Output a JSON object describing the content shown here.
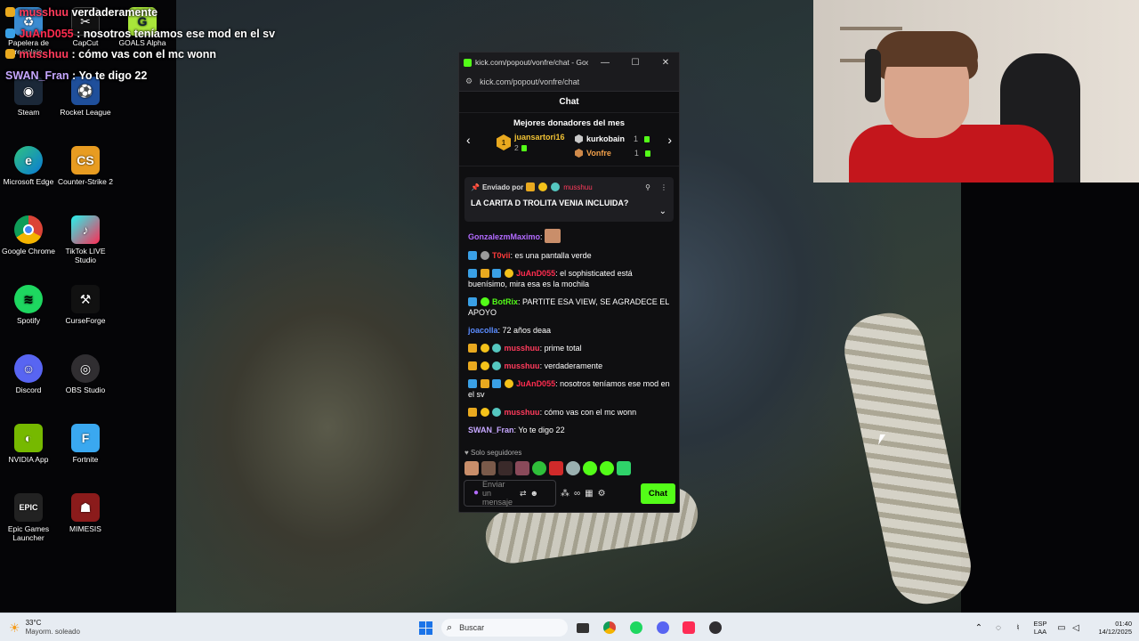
{
  "overlay_chat": [
    {
      "user": "musshuu",
      "text": "verdaderamente",
      "user_color": "#ff3b5c"
    },
    {
      "user": "JuAnD055",
      "text": ": nosotros teníamos ese mod en el sv",
      "user_color": "#ff2c4f"
    },
    {
      "user": "musshuu",
      "text": ": cómo vas con el mc wonn",
      "user_color": "#ff3b5c"
    },
    {
      "user": "SWAN_Fran",
      "text": ": Yo te digo 22",
      "user_color": "#c6a7ff"
    }
  ],
  "desktop": {
    "icons": [
      {
        "label": "Papelera de reciclaje",
        "icon": "recycle-bin-icon"
      },
      {
        "label": "CapCut",
        "icon": "capcut-icon"
      },
      {
        "label": "GOALS Alpha",
        "icon": "goals-icon"
      },
      {
        "label": "Steam",
        "icon": "steam-icon"
      },
      {
        "label": "Rocket League",
        "icon": "rocket-league-icon"
      },
      {
        "label": "Microsoft Edge",
        "icon": "edge-icon"
      },
      {
        "label": "Counter-Strike 2",
        "icon": "cs2-icon"
      },
      {
        "label": "Google Chrome",
        "icon": "chrome-icon"
      },
      {
        "label": "TikTok LIVE Studio",
        "icon": "tiktok-icon"
      },
      {
        "label": "Spotify",
        "icon": "spotify-icon"
      },
      {
        "label": "CurseForge",
        "icon": "curseforge-icon"
      },
      {
        "label": "Discord",
        "icon": "discord-icon"
      },
      {
        "label": "OBS Studio",
        "icon": "obs-icon"
      },
      {
        "label": "NVIDIA App",
        "icon": "nvidia-icon"
      },
      {
        "label": "Fortnite",
        "icon": "fortnite-icon"
      },
      {
        "label": "Epic Games Launcher",
        "icon": "epic-icon"
      },
      {
        "label": "MIMESIS",
        "icon": "mimesis-icon"
      }
    ]
  },
  "chat_window": {
    "title": "kick.com/popout/vonfre/chat - Googl...",
    "url": "kick.com/popout/vonfre/chat",
    "header": "Chat",
    "donors_title": "Mejores donadores del mes",
    "donors": [
      {
        "rank": "1",
        "name": "juansartori16",
        "count": "2"
      },
      {
        "rank": "2",
        "name": "kurkobain",
        "count": "1"
      },
      {
        "rank": "3",
        "name": "Vonfre",
        "count": "1"
      }
    ],
    "pinned": {
      "sent_by": "Enviado por",
      "user": "musshuu",
      "message": "LA CARITA D TROLITA VENIA INCLUIDA?"
    },
    "messages": [
      {
        "user": "GonzalezmMaximo",
        "text": ":",
        "color": "#b36bff"
      },
      {
        "user": "T0vii",
        "text": ": es una pantalla verde",
        "color": "#ff3b3b"
      },
      {
        "user": "JuAnD055",
        "text": ": el sophisticated está buenísimo, mira esa es la mochila",
        "color": "#ff2c4f"
      },
      {
        "user": "BotRix",
        "text": ": PARTITE ESA VIEW, SE AGRADECE EL APOYO",
        "color": "#53fc18"
      },
      {
        "user": "joacolla",
        "text": ": 72 años deaa",
        "color": "#5b8cff"
      },
      {
        "user": "musshuu",
        "text": ": prime total",
        "color": "#ff3b5c"
      },
      {
        "user": "musshuu",
        "text": ": verdaderamente",
        "color": "#ff3b5c"
      },
      {
        "user": "JuAnD055",
        "text": ": nosotros teníamos ese mod en el sv",
        "color": "#ff2c4f"
      },
      {
        "user": "musshuu",
        "text": ": cómo vas con el mc wonn",
        "color": "#ff3b5c"
      },
      {
        "user": "SWAN_Fran",
        "text": ": Yo te digo 22",
        "color": "#c6a7ff"
      }
    ],
    "followers_only": "Solo seguidores",
    "input_placeholder": "Enviar un mensaje",
    "send_label": "Chat"
  },
  "taskbar": {
    "weather_temp": "33°C",
    "weather_desc": "Mayorm. soleado",
    "search_label": "Buscar",
    "lang_top": "ESP",
    "lang_bottom": "LAA",
    "time": "01:40",
    "date": "14/12/2025"
  },
  "colors": {
    "kick_green": "#53fc18",
    "taskbar_bg": "#e7ecf2"
  }
}
